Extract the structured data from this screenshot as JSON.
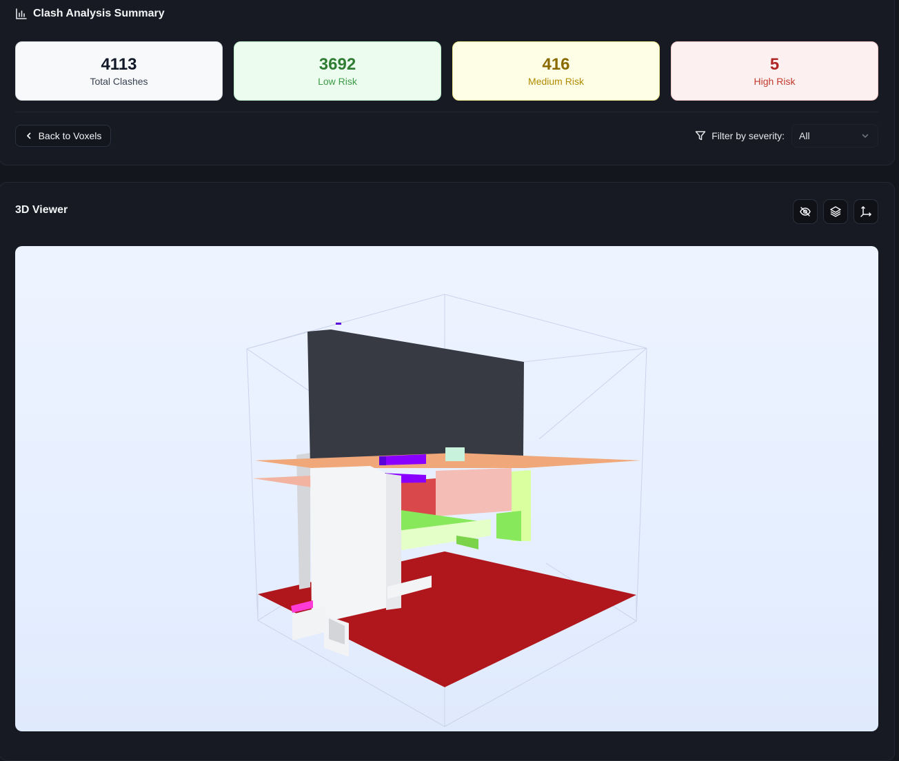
{
  "summary": {
    "title": "Clash Analysis Summary",
    "icon": "bar-chart-icon",
    "cards": {
      "total": {
        "value": "4113",
        "label": "Total Clashes"
      },
      "low": {
        "value": "3692",
        "label": "Low Risk",
        "color": "#2e7d32"
      },
      "medium": {
        "value": "416",
        "label": "Medium Risk",
        "color": "#8a6a00"
      },
      "high": {
        "value": "5",
        "label": "High Risk",
        "color": "#b02525"
      }
    }
  },
  "toolbar": {
    "back_label": "Back to Voxels",
    "filter_label": "Filter by severity:",
    "filter_value": "All"
  },
  "viewer": {
    "title": "3D Viewer",
    "tools": [
      "eye-off-icon",
      "layers-icon",
      "axes-icon"
    ],
    "colors": {
      "background": "#eef4ff",
      "floor": "#b0171c",
      "wall": "#373a43",
      "slab": "#f0a77a",
      "duct": "#cfff8f",
      "pipe": "#8a00ff"
    }
  }
}
